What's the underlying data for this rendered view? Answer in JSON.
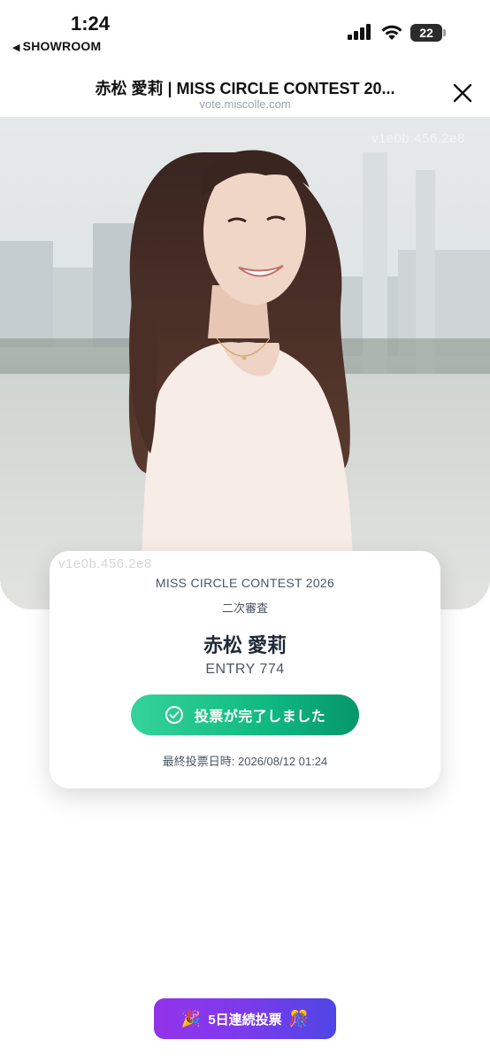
{
  "status": {
    "time": "1:24",
    "back_app": "SHOWROOM",
    "battery": "22"
  },
  "browser": {
    "title": "赤松 愛莉 | MISS CIRCLE CONTEST 20...",
    "url": "vote.miscolle.com"
  },
  "photo": {
    "watermark": "v1e0b.456.2e8"
  },
  "card": {
    "contest": "MISS CIRCLE CONTEST 2026",
    "stage": "二次審査",
    "name": "赤松 愛莉",
    "entry": "ENTRY 774",
    "vote_done_label": "投票が完了しました",
    "last_vote": "最終投票日時: 2026/08/12 01:24"
  },
  "streak": {
    "label": "5日連続投票",
    "left_emoji": "🎉",
    "right_emoji": "🎊"
  },
  "colors": {
    "success_green": "#10b981",
    "streak_purple": "#7c3aed"
  }
}
